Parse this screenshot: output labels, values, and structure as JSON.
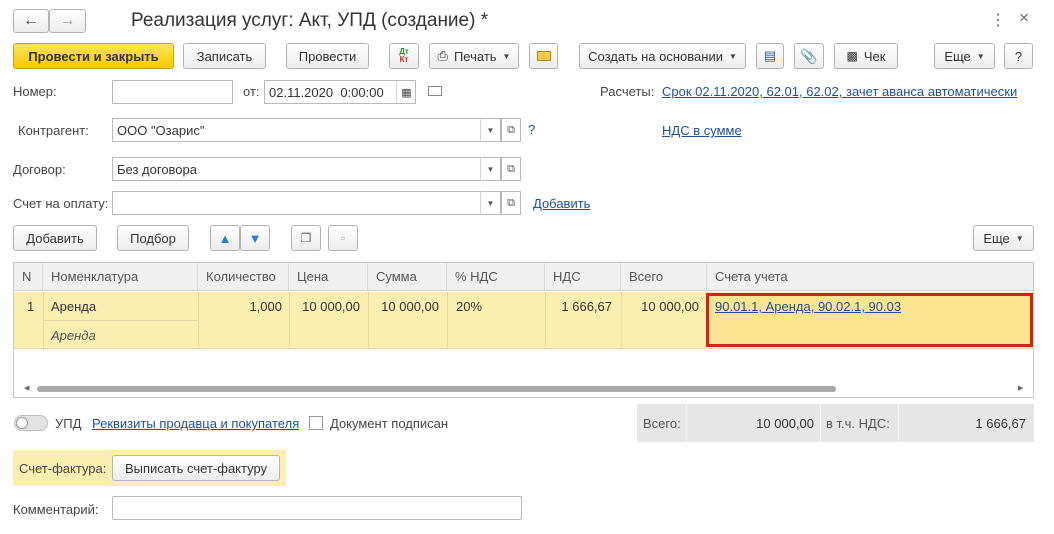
{
  "window": {
    "title": "Реализация услуг: Акт, УПД (создание) *"
  },
  "toolbar": {
    "post_close": "Провести и закрыть",
    "save": "Записать",
    "post": "Провести",
    "dtkt_top": "Дт",
    "dtkt_bottom": "Кт",
    "print": "Печать",
    "create_based": "Создать на основании",
    "receipt": "Чек",
    "more": "Еще",
    "help": "?"
  },
  "form": {
    "number_label": "Номер:",
    "number_value": "",
    "date_label": "от:",
    "date_value": "02.11.2020  0:00:00",
    "settlements_label": "Расчеты:",
    "settlements_link": "Срок 02.11.2020, 62.01, 62.02, зачет аванса автоматически",
    "counterparty_label": "Контрагент:",
    "counterparty_value": "ООО \"Озарис\"",
    "question": "?",
    "vat_link": "НДС в сумме",
    "contract_label": "Договор:",
    "contract_value": "Без договора",
    "invoice_label": "Счет на оплату:",
    "invoice_value": "",
    "add_link": "Добавить"
  },
  "table_toolbar": {
    "add": "Добавить",
    "select": "Подбор",
    "more": "Еще"
  },
  "table": {
    "headers": [
      "N",
      "Номенклатура",
      "Количество",
      "Цена",
      "Сумма",
      "% НДС",
      "НДС",
      "Всего",
      "Счета учета"
    ],
    "rows": [
      {
        "n": "1",
        "item": "Аренда",
        "item_sub": "Аренда",
        "qty": "1,000",
        "price": "10 000,00",
        "sum": "10 000,00",
        "vat_rate": "20%",
        "vat": "1 666,67",
        "total": "10 000,00",
        "accounts": "90.01.1, Аренда, 90.02.1, 90.03"
      }
    ]
  },
  "footer": {
    "upd_label": "УПД",
    "requisites_link": "Реквизиты продавца и покупателя",
    "signed_label": "Документ подписан",
    "total_label": "Всего:",
    "total_value": "10 000,00",
    "vat_incl_label": "в т.ч. НДС:",
    "vat_incl_value": "1 666,67",
    "invoice_label": "Счет-фактура:",
    "issue_invoice": "Выписать счет-фактуру",
    "comment_label": "Комментарий:",
    "comment_value": ""
  },
  "colors": {
    "primary": "#f5c800",
    "row_selected": "#fbeeb1",
    "highlight_border": "#d42020",
    "link": "#1a4f9c"
  }
}
